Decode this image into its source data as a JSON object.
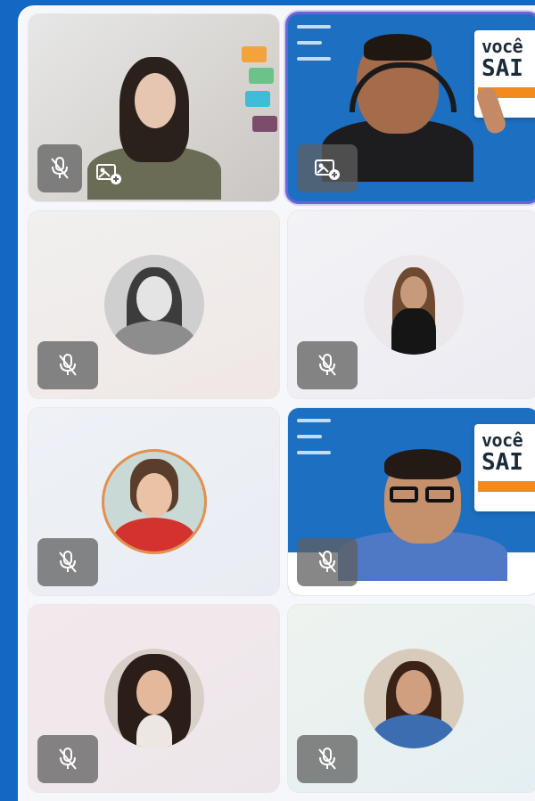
{
  "meeting": {
    "participants": [
      {
        "id": "p1",
        "mic": "muted",
        "video": "camera",
        "pin_control": true,
        "active_speaker": false
      },
      {
        "id": "p2",
        "mic": "unmuted",
        "video": "camera-with-shared-slide",
        "pin_control": true,
        "active_speaker": true
      },
      {
        "id": "p3",
        "mic": "muted",
        "video": "avatar",
        "pin_control": false,
        "active_speaker": false
      },
      {
        "id": "p4",
        "mic": "muted",
        "video": "avatar",
        "pin_control": false,
        "active_speaker": false
      },
      {
        "id": "p5",
        "mic": "muted",
        "video": "avatar",
        "pin_control": false,
        "active_speaker": false
      },
      {
        "id": "p6",
        "mic": "muted",
        "video": "camera-with-shared-slide",
        "pin_control": false,
        "active_speaker": false
      },
      {
        "id": "p7",
        "mic": "muted",
        "video": "avatar",
        "pin_control": false,
        "active_speaker": false
      },
      {
        "id": "p8",
        "mic": "muted",
        "video": "avatar",
        "pin_control": false,
        "active_speaker": false
      }
    ],
    "shared_slide": {
      "line1": "você",
      "line2": "SAI"
    }
  },
  "icons": {
    "mic_muted": "mic-muted-icon",
    "pin_video": "pin-video-icon"
  },
  "colors": {
    "frame_blue": "#1368c4",
    "active_border": "#6b63d8",
    "slide_blue": "#1d6fc2",
    "slide_orange": "#f28a1c",
    "control_gray": "#5f5f5f"
  }
}
